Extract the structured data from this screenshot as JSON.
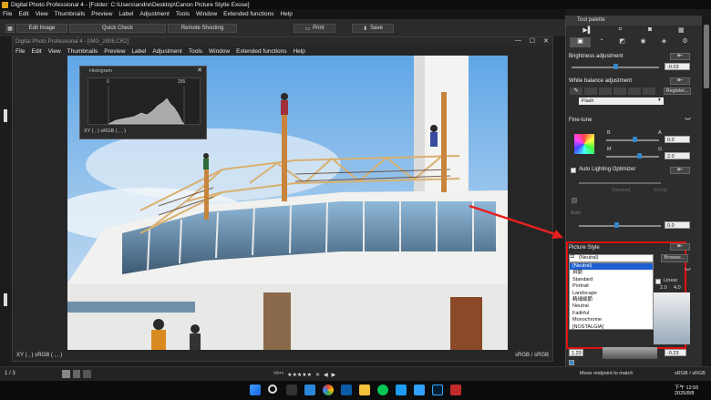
{
  "outer_title": "Digital Photo Professional 4 - [Folder: C:\\Users\\andre\\Desktop\\Canon Picture Stytle Exose]",
  "outer_menu": [
    "File",
    "Edit",
    "View",
    "Thumbnails",
    "Preview",
    "Label",
    "Adjustment",
    "Tools",
    "Window",
    "Extended functions",
    "Help"
  ],
  "toolbar": {
    "edit_image": "Edit Image",
    "quick_check": "Quick Check",
    "remote_shooting": "Remote Shooting",
    "print": "Print",
    "save": "Save"
  },
  "inner_window": {
    "title": "Digital Photo Professional 4 - [IMG_2806.CR2]",
    "menu": [
      "File",
      "Edit",
      "View",
      "Thumbnails",
      "Preview",
      "Label",
      "Adjustment",
      "Tools",
      "Window",
      "Extended functions",
      "Help"
    ],
    "status_left": "XY (    ,    )   sRGB (    ,    ,    )",
    "status_right": "sRGB / sRGB"
  },
  "histogram": {
    "title": "Histogram",
    "min": "0",
    "max": "255",
    "readout": "XY (    ,    )   sRGB (    ,    ,    )"
  },
  "bottom_bar": {
    "page_count": "1 / 3",
    "status_right": "sRGB / sRGB",
    "move_midpoint": "Move midpoint to match"
  },
  "tool_palette": {
    "title": "Tool palette",
    "brightness": {
      "label": "Brightness adjustment",
      "value": "-0.03"
    },
    "white_balance": {
      "label": "White balance adjustment",
      "register": "Register...",
      "selected": "Flash"
    },
    "fine_tune": {
      "label": "Fine-tune",
      "b": "B",
      "a": "A",
      "m": "M",
      "g": "G",
      "ba_value": "0.0",
      "mg_value": "2.0"
    },
    "alo": {
      "label": "Auto Lighting Optimizer",
      "sub": "Standard",
      "sub2": "Strong"
    },
    "sub_panel": {
      "label": "Auto",
      "value": "0.0"
    },
    "picture_style": {
      "label": "Picture Style",
      "selected": "(Neutral)",
      "browse": "Browse...",
      "options": [
        "(Neutral)",
        "自動",
        "Standard",
        "Portrait",
        "Landscape",
        "精細細節",
        "Neutral",
        "Faithful",
        "Monochrome",
        "[NOSTALGIA]"
      ],
      "highlighted_index": 0
    },
    "tone": {
      "linear": "Linear",
      "v1": "2.0",
      "v2": "4.0"
    },
    "bottom_values": {
      "left": "1.23",
      "right": "-0.23"
    }
  },
  "clock": {
    "time": "下午 12:56",
    "date": "2025/8/8"
  },
  "colors": {
    "accent": "#3388cc",
    "highlight_red": "#e01010",
    "arrow": "#e82020"
  }
}
